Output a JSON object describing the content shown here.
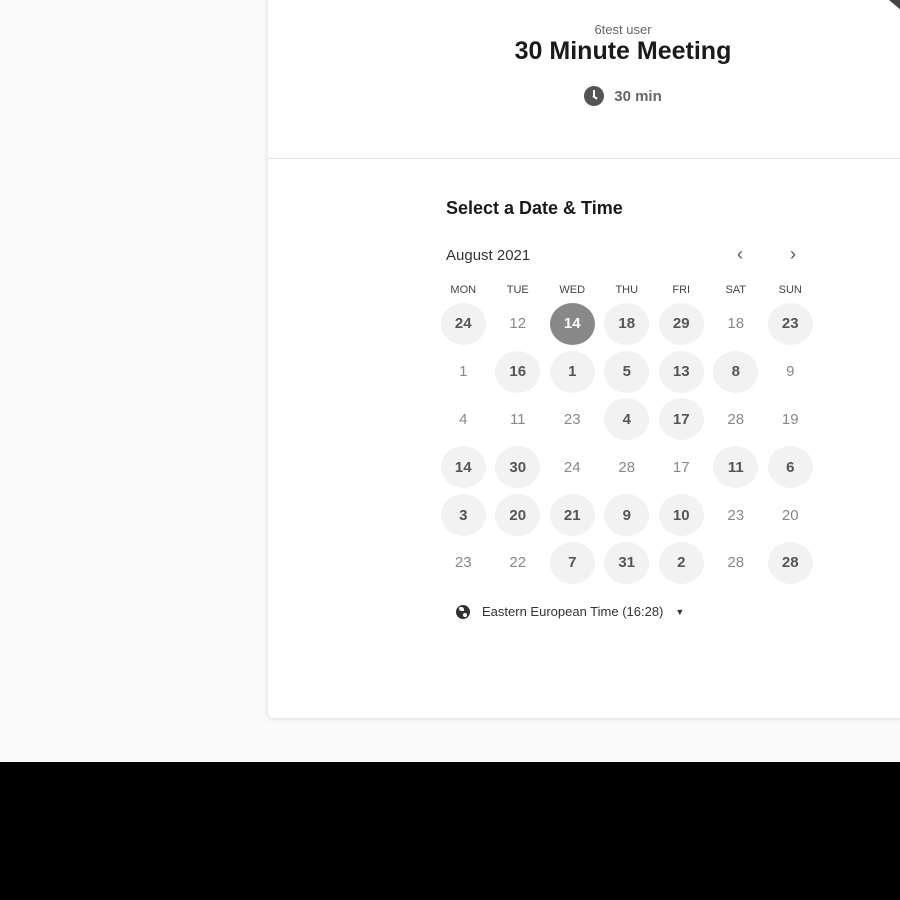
{
  "header": {
    "host_name": "6test user",
    "event_title": "30 Minute Meeting",
    "duration": "30 min",
    "duration_icon": "clock-icon"
  },
  "calendar": {
    "section_title": "Select a Date & Time",
    "month": "August 2021",
    "prev_icon": "chevron-left-icon",
    "prev_glyph": "‹",
    "next_icon": "chevron-right-icon",
    "next_glyph": "›",
    "weekdays": [
      "MON",
      "TUE",
      "WED",
      "THU",
      "FRI",
      "SAT",
      "SUN"
    ],
    "weeks": [
      [
        {
          "day": "24",
          "status": "available"
        },
        {
          "day": "12",
          "status": "unavailable"
        },
        {
          "day": "14",
          "status": "selected"
        },
        {
          "day": "18",
          "status": "available"
        },
        {
          "day": "29",
          "status": "available"
        },
        {
          "day": "18",
          "status": "unavailable"
        },
        {
          "day": "23",
          "status": "available"
        }
      ],
      [
        {
          "day": "1",
          "status": "unavailable"
        },
        {
          "day": "16",
          "status": "available"
        },
        {
          "day": "1",
          "status": "available"
        },
        {
          "day": "5",
          "status": "available"
        },
        {
          "day": "13",
          "status": "available"
        },
        {
          "day": "8",
          "status": "available"
        },
        {
          "day": "9",
          "status": "unavailable"
        }
      ],
      [
        {
          "day": "4",
          "status": "unavailable"
        },
        {
          "day": "11",
          "status": "unavailable"
        },
        {
          "day": "23",
          "status": "unavailable"
        },
        {
          "day": "4",
          "status": "available"
        },
        {
          "day": "17",
          "status": "available"
        },
        {
          "day": "28",
          "status": "unavailable"
        },
        {
          "day": "19",
          "status": "unavailable"
        }
      ],
      [
        {
          "day": "14",
          "status": "available"
        },
        {
          "day": "30",
          "status": "available"
        },
        {
          "day": "24",
          "status": "unavailable"
        },
        {
          "day": "28",
          "status": "unavailable"
        },
        {
          "day": "17",
          "status": "unavailable"
        },
        {
          "day": "11",
          "status": "available"
        },
        {
          "day": "6",
          "status": "available"
        }
      ],
      [
        {
          "day": "3",
          "status": "available"
        },
        {
          "day": "20",
          "status": "available"
        },
        {
          "day": "21",
          "status": "available"
        },
        {
          "day": "9",
          "status": "available"
        },
        {
          "day": "10",
          "status": "available"
        },
        {
          "day": "23",
          "status": "unavailable"
        },
        {
          "day": "20",
          "status": "unavailable"
        }
      ],
      [
        {
          "day": "23",
          "status": "unavailable"
        },
        {
          "day": "22",
          "status": "unavailable"
        },
        {
          "day": "7",
          "status": "available"
        },
        {
          "day": "31",
          "status": "available"
        },
        {
          "day": "2",
          "status": "available"
        },
        {
          "day": "28",
          "status": "unavailable"
        },
        {
          "day": "28",
          "status": "available"
        }
      ]
    ]
  },
  "timezone": {
    "label": "Eastern European Time (16:28)",
    "icon": "globe-icon",
    "dropdown_icon": "caret-down-icon",
    "caret_glyph": "▼"
  },
  "colors": {
    "available_bg": "#f2f2f2",
    "selected_bg": "#888888",
    "card_bg": "#ffffff",
    "page_bg": "#fafafa",
    "outer_bg": "#000000"
  }
}
